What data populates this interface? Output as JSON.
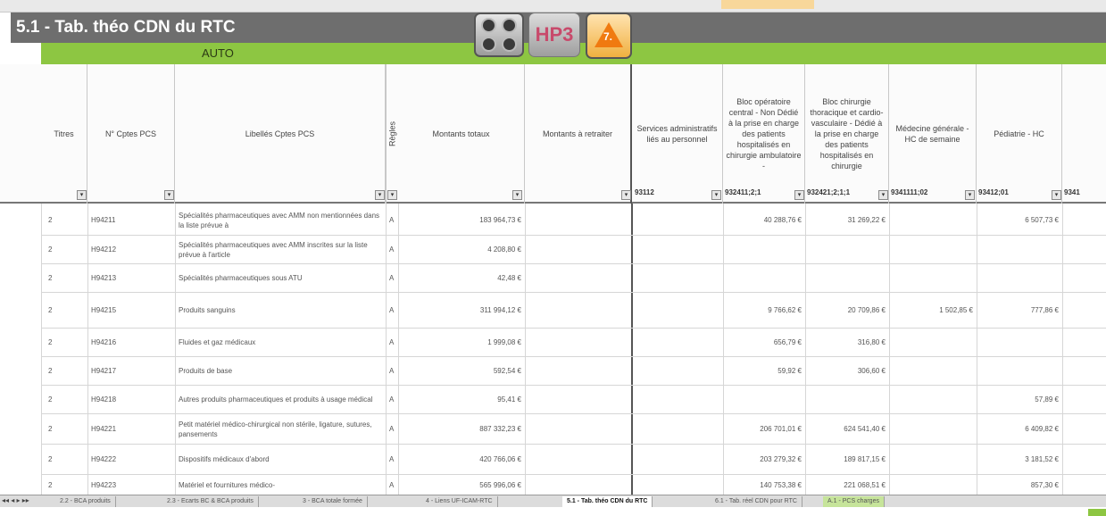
{
  "sheet": {
    "title": "5.1 - Tab. théo CDN du RTC",
    "band_label": "AUTO",
    "hp3_label": "HP3",
    "warn_label": "7."
  },
  "columns": [
    {
      "label": "Titres",
      "code": ""
    },
    {
      "label": "N° Cptes PCS",
      "code": ""
    },
    {
      "label": "Libellés Cptes PCS",
      "code": ""
    },
    {
      "label": "Règles",
      "code": ""
    },
    {
      "label": "Montants totaux",
      "code": ""
    },
    {
      "label": "Montants à retraiter",
      "code": ""
    },
    {
      "label": "Services administratifs liés au personnel",
      "code": "93112"
    },
    {
      "label": "Bloc opératoire central - Non Dédié à la prise en charge des patients hospitalisés en chirurgie ambulatoire -",
      "code": "932411;2;1"
    },
    {
      "label": "Bloc chirurgie thoracique et cardio-vasculaire - Dédié à la prise en charge des patients hospitalisés en chirurgie",
      "code": "932421;2;1;1"
    },
    {
      "label": "Médecine générale - HC de semaine",
      "code": "9341111;02"
    },
    {
      "label": "Pédiatrie - HC",
      "code": "93412;01"
    },
    {
      "label": "",
      "code": "9341"
    }
  ],
  "rows": [
    {
      "titre": "2",
      "num": "H94211",
      "lib": "Spécialités pharmaceutiques avec AMM non mentionnées dans la liste prévue à",
      "regle": "A",
      "total": "183 964,73 €",
      "c1": "",
      "c2": "40 288,76 €",
      "c3": "31 269,22 €",
      "c4": "",
      "c5": "6 507,73 €"
    },
    {
      "titre": "2",
      "num": "H94212",
      "lib": "Spécialités pharmaceutiques avec AMM inscrites sur la liste prévue à l'article",
      "regle": "A",
      "total": "4 208,80 €",
      "c1": "",
      "c2": "",
      "c3": "",
      "c4": "",
      "c5": ""
    },
    {
      "titre": "2",
      "num": "H94213",
      "lib": "Spécialités pharmaceutiques sous ATU",
      "regle": "A",
      "total": "42,48 €",
      "c1": "",
      "c2": "",
      "c3": "",
      "c4": "",
      "c5": ""
    },
    {
      "titre": "2",
      "num": "H94215",
      "lib": "Produits sanguins",
      "regle": "A",
      "total": "311 994,12 €",
      "c1": "",
      "c2": "9 766,62 €",
      "c3": "20 709,86 €",
      "c4": "1 502,85 €",
      "c5": "777,86 €"
    },
    {
      "titre": "2",
      "num": "H94216",
      "lib": "Fluides et gaz médicaux",
      "regle": "A",
      "total": "1 999,08 €",
      "c1": "",
      "c2": "656,79 €",
      "c3": "316,80 €",
      "c4": "",
      "c5": ""
    },
    {
      "titre": "2",
      "num": "H94217",
      "lib": "Produits de base",
      "regle": "A",
      "total": "592,54 €",
      "c1": "",
      "c2": "59,92 €",
      "c3": "306,60 €",
      "c4": "",
      "c5": ""
    },
    {
      "titre": "2",
      "num": "H94218",
      "lib": "Autres produits pharmaceutiques et produits à usage médical",
      "regle": "A",
      "total": "95,41 €",
      "c1": "",
      "c2": "",
      "c3": "",
      "c4": "",
      "c5": "57,89 €"
    },
    {
      "titre": "2",
      "num": "H94221",
      "lib": "Petit matériel médico-chirurgical non stérile, ligature, sutures, pansements",
      "regle": "A",
      "total": "887 332,23 €",
      "c1": "",
      "c2": "206 701,01 €",
      "c3": "624 541,40 €",
      "c4": "",
      "c5": "6 409,82 €"
    },
    {
      "titre": "2",
      "num": "H94222",
      "lib": "Dispositifs médicaux d'abord",
      "regle": "A",
      "total": "420 766,06 €",
      "c1": "",
      "c2": "203 279,32 €",
      "c3": "189 817,15 €",
      "c4": "",
      "c5": "3 181,52 €"
    },
    {
      "titre": "2",
      "num": "H94223",
      "lib": "Matériel et fournitures médico-",
      "regle": "A",
      "total": "565 996,06 €",
      "c1": "",
      "c2": "140 753,38 €",
      "c3": "221 068,51 €",
      "c4": "",
      "c5": "857,30 €"
    }
  ],
  "tabs": [
    "2.2 - BCA produits",
    "2.3 - Ecarts BC & BCA produits",
    "3 - BCA totale formée",
    "4 - Liens UF-ICAM-RTC",
    "5.1 - Tab. théo CDN du RTC",
    "6.1 - Tab. réel CDN pour RTC",
    "A.1 - PCS charges"
  ],
  "active_tab": "5.1 - Tab. théo CDN du RTC",
  "scroll_arrows": "◂◂ ◂ ▸ ▸▸"
}
